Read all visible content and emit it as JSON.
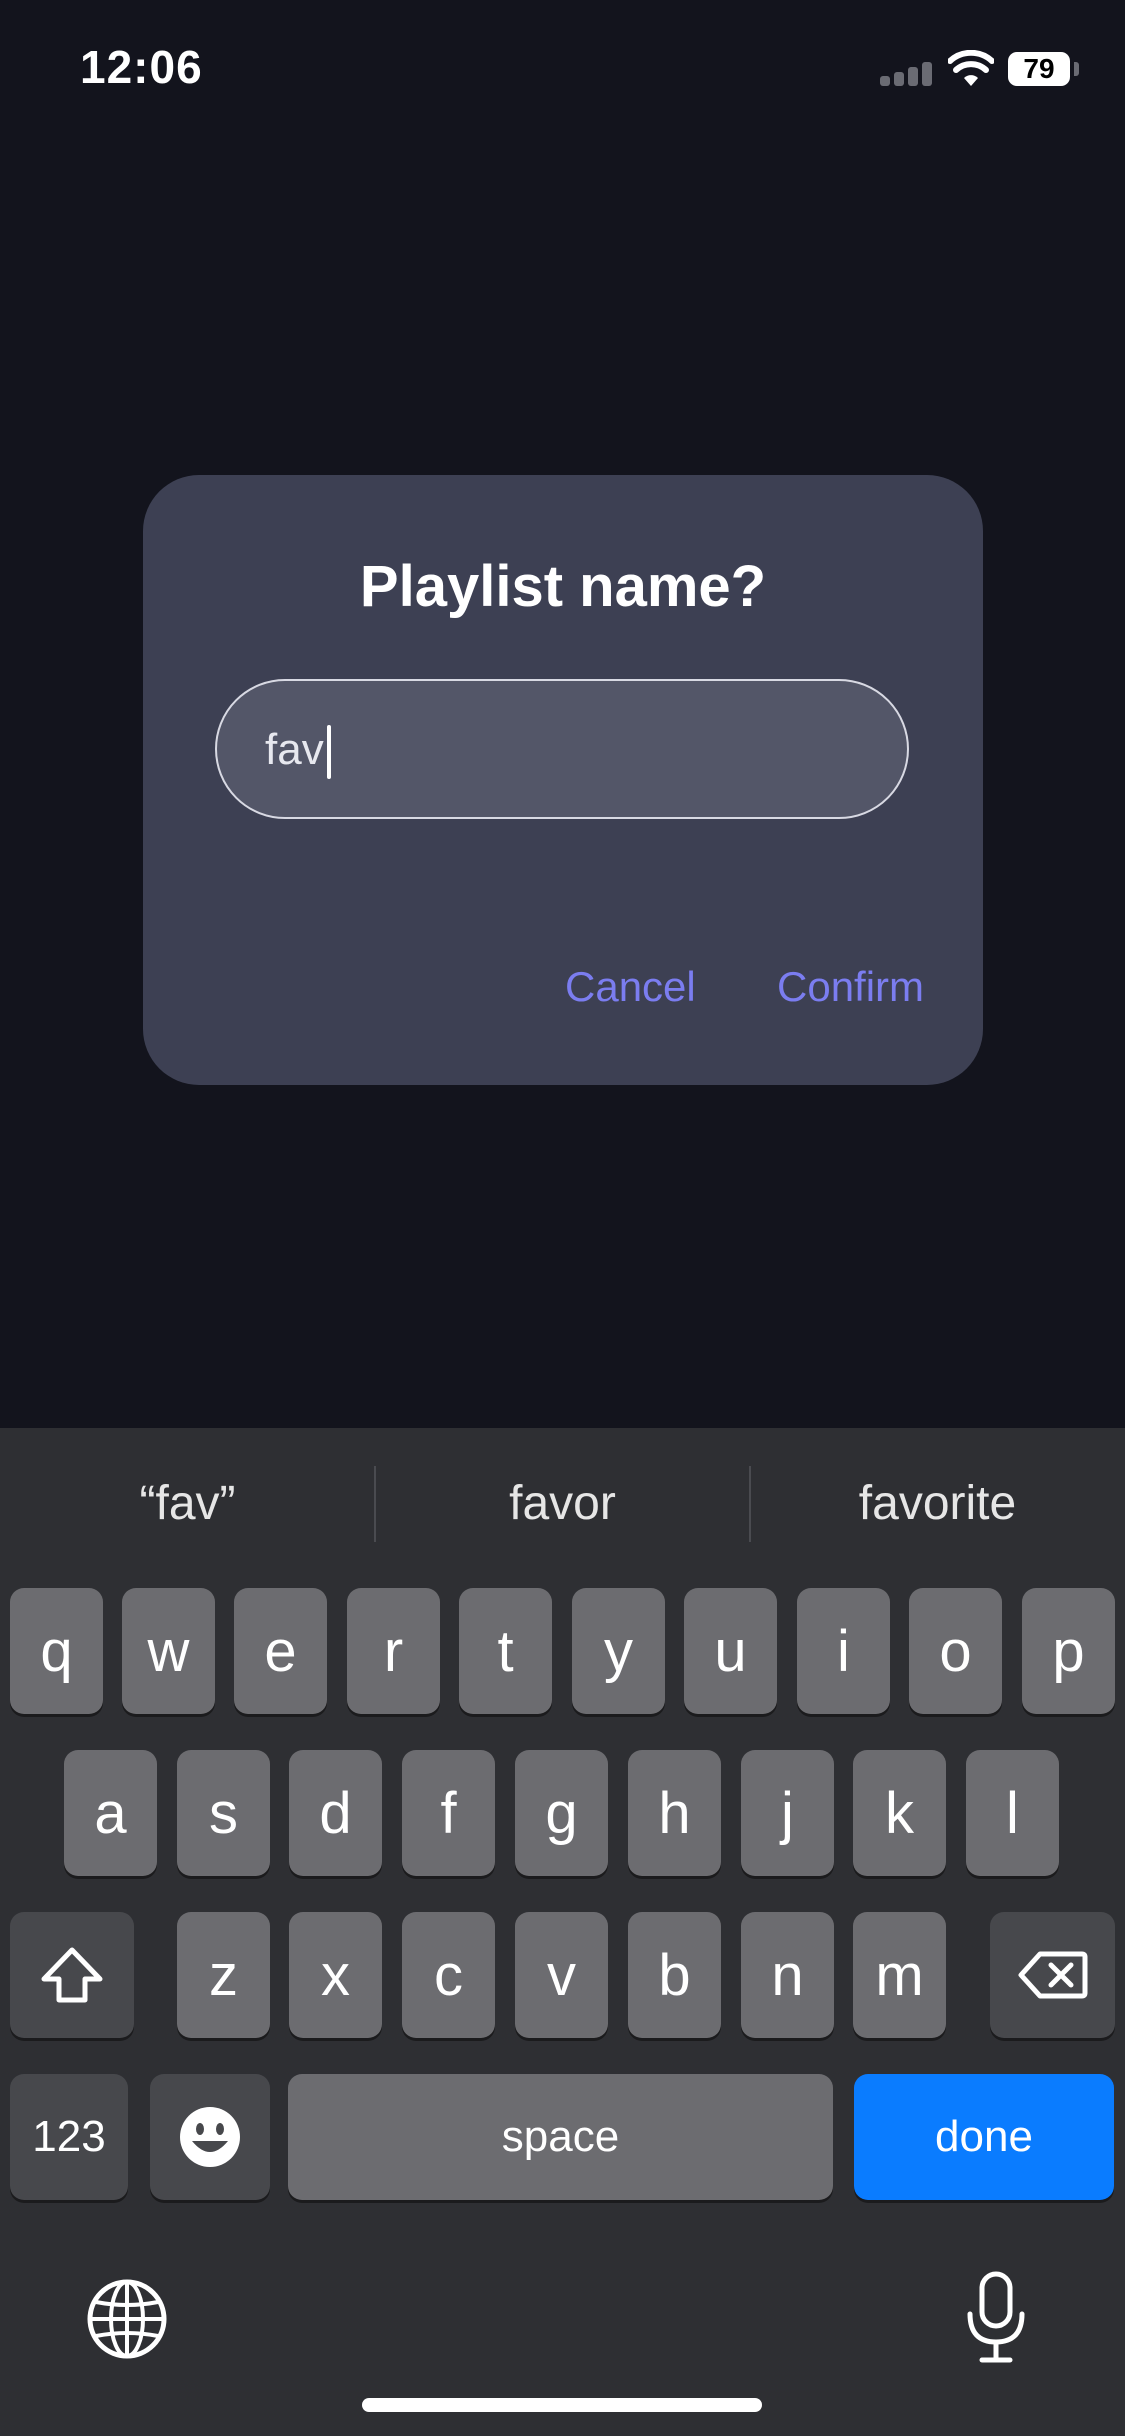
{
  "status_bar": {
    "time": "12:06",
    "battery": "79",
    "signal_icon": "cellular-signal-icon",
    "wifi_icon": "wifi-icon"
  },
  "dialog": {
    "title": "Playlist name?",
    "input_value": "fav",
    "cancel_label": "Cancel",
    "confirm_label": "Confirm",
    "accent_color": "#7b7df0"
  },
  "keyboard": {
    "suggestions": [
      "“fav”",
      "favor",
      "favorite"
    ],
    "row1": [
      "q",
      "w",
      "e",
      "r",
      "t",
      "y",
      "u",
      "i",
      "o",
      "p"
    ],
    "row2": [
      "a",
      "s",
      "d",
      "f",
      "g",
      "h",
      "j",
      "k",
      "l"
    ],
    "row3": [
      "z",
      "x",
      "c",
      "v",
      "b",
      "n",
      "m"
    ],
    "numbers_label": "123",
    "space_label": "space",
    "done_label": "done",
    "done_color": "#0a7cff",
    "icons": [
      "shift-icon",
      "backspace-icon",
      "emoji-icon",
      "globe-icon",
      "microphone-icon"
    ]
  }
}
